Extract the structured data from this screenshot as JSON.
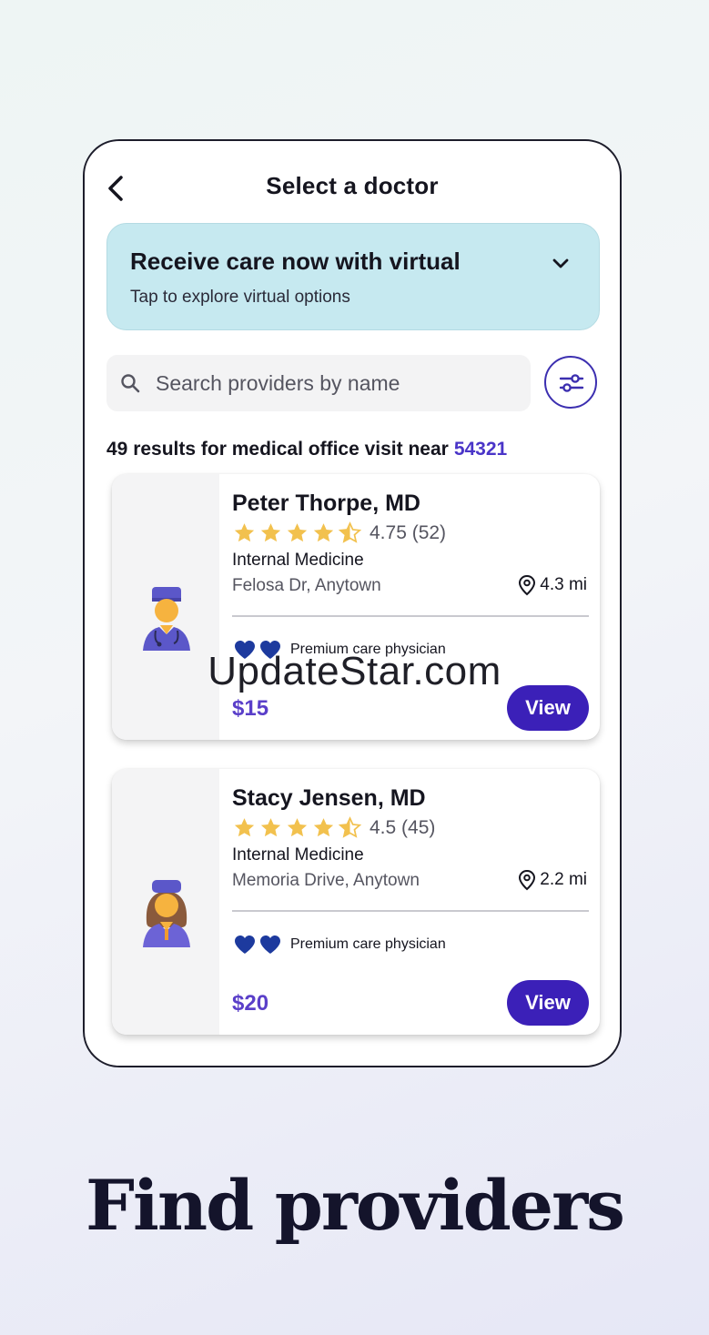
{
  "header": {
    "title": "Select a doctor",
    "back_icon": "chevron-left-icon"
  },
  "virtual_banner": {
    "title": "Receive care now with virtual",
    "subtitle": "Tap to explore virtual options",
    "icon": "chevron-down-icon",
    "bg_color": "#c6e9f0"
  },
  "search": {
    "placeholder": "Search providers by name",
    "icon": "search-icon"
  },
  "filter": {
    "icon": "sliders-icon"
  },
  "results": {
    "text": "49 results for medical office visit near",
    "zip": "54321"
  },
  "providers": [
    {
      "name": "Peter Thorpe, MD",
      "rating": 4.75,
      "score_text": "4.75 (52)",
      "specialty": "Internal Medicine",
      "address": "Felosa Dr, Anytown",
      "distance": "4.3 mi",
      "badge": "Premium care physician",
      "price": "$15",
      "button": "View"
    },
    {
      "name": "Stacy Jensen, MD",
      "rating": 4.5,
      "score_text": "4.5 (45)",
      "specialty": "Internal Medicine",
      "address": "Memoria Drive, Anytown",
      "distance": "2.2 mi",
      "badge": "Premium care physician",
      "price": "$20",
      "button": "View"
    }
  ],
  "watermark": "UpdateStar.com",
  "headline": "Find providers",
  "colors": {
    "accent": "#3b20b8",
    "price": "#5a3fc9",
    "star": "#f2c14e",
    "heart": "#1d3a9e"
  }
}
